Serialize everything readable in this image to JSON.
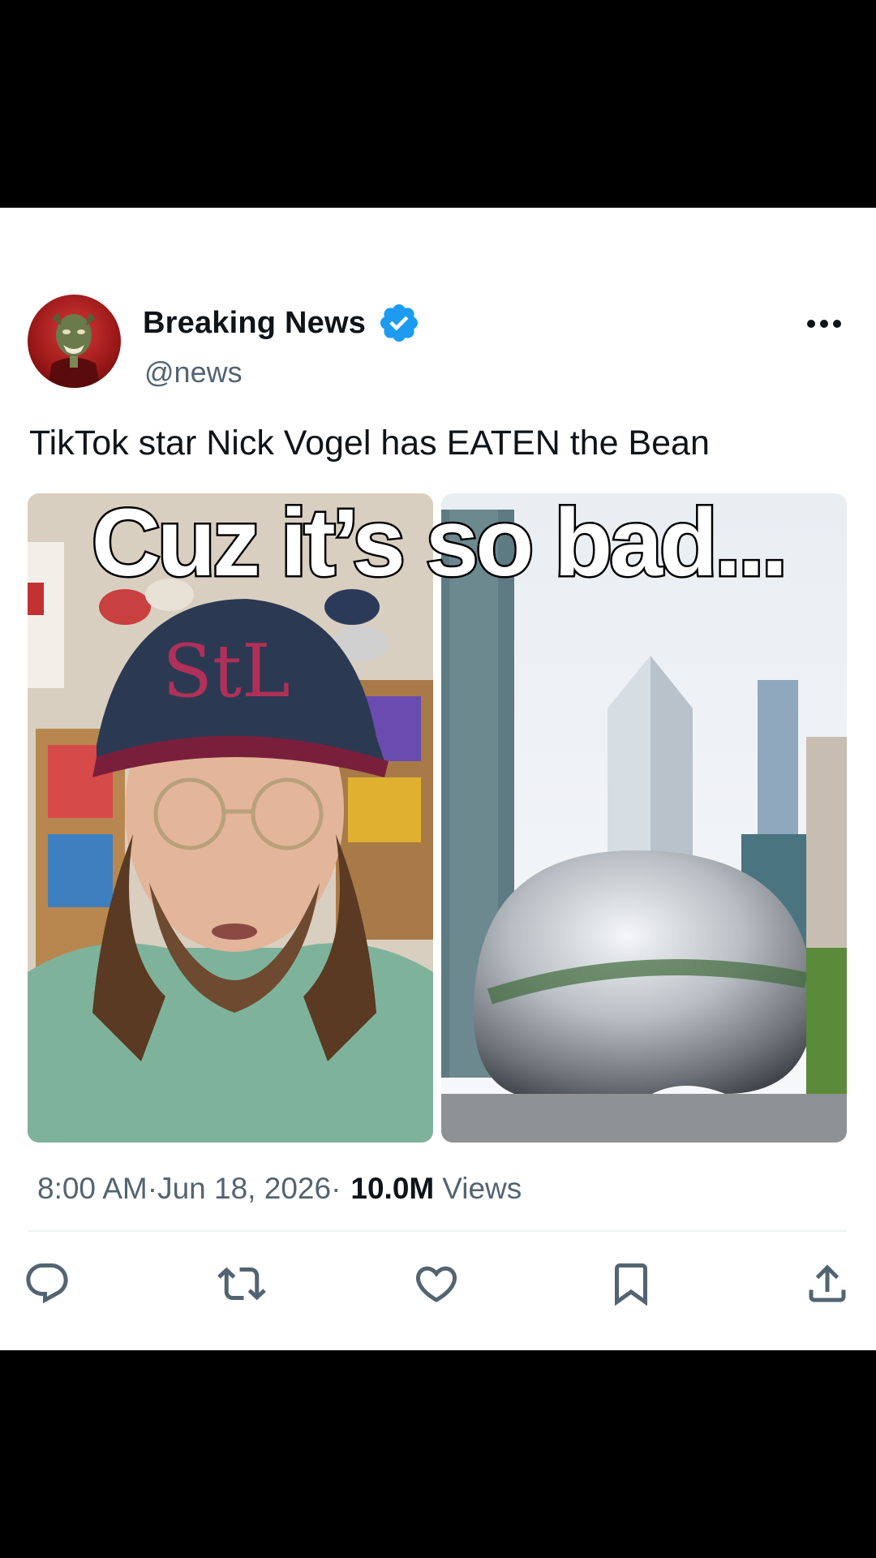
{
  "tweet": {
    "display_name": "Breaking News",
    "handle": "@news",
    "text": "TikTok star Nick Vogel has EATEN the Bean",
    "caption_overlay": "Cuz it’s so bad...",
    "time": "8:00 AM",
    "date_sep": "·",
    "date": "Jun 18, 2026",
    "views_sep": "·",
    "views_count": "10.0M",
    "views_label": "Views"
  },
  "icons": {
    "verified": "verified-badge-icon",
    "more": "more-options-icon",
    "reply": "reply-icon",
    "retweet": "retweet-icon",
    "like": "heart-icon",
    "bookmark": "bookmark-icon",
    "share": "share-icon"
  },
  "colors": {
    "verified_blue": "#1d9bf0",
    "text_primary": "#0f1419",
    "text_secondary": "#536471",
    "icon_gray": "#536471"
  }
}
